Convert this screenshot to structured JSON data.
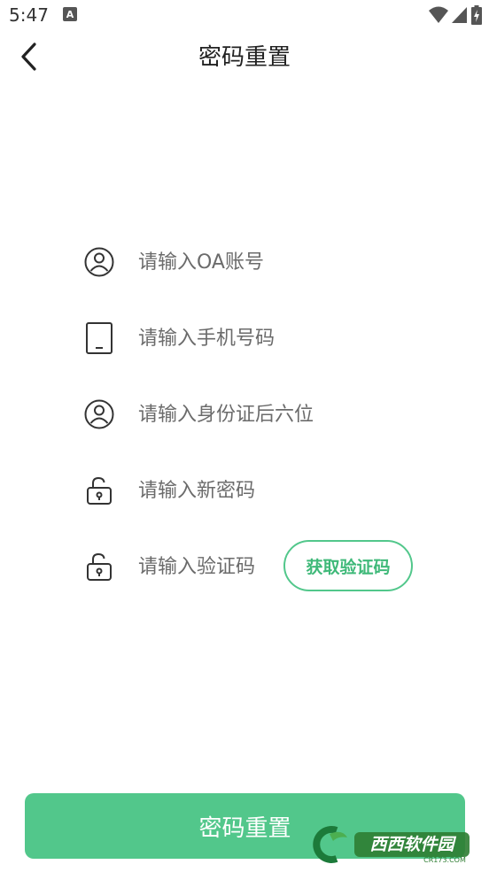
{
  "status_bar": {
    "time": "5:47",
    "notification_icon": "a-badge-icon",
    "right_icons": [
      "wifi-icon",
      "signal-icon",
      "battery-charging-icon"
    ]
  },
  "header": {
    "back_icon": "chevron-left-icon",
    "title": "密码重置"
  },
  "form": {
    "account": {
      "icon": "user-circle-icon",
      "placeholder": "请输入OA账号",
      "value": ""
    },
    "phone": {
      "icon": "phone-icon",
      "placeholder": "请输入手机号码",
      "value": ""
    },
    "id_card": {
      "icon": "user-circle-icon",
      "placeholder": "请输入身份证后六位",
      "value": ""
    },
    "new_password": {
      "icon": "unlock-icon",
      "placeholder": "请输入新密码",
      "value": ""
    },
    "code": {
      "icon": "unlock-icon",
      "placeholder": "请输入验证码",
      "value": "",
      "button_label": "获取验证码"
    }
  },
  "submit_label": "密码重置",
  "watermark": {
    "brand": "西西软件园",
    "site": "CR173.COM"
  },
  "colors": {
    "accent": "#52c78b",
    "accent_text": "#3fb979",
    "text": "#222222",
    "placeholder": "#6b6b6b"
  }
}
